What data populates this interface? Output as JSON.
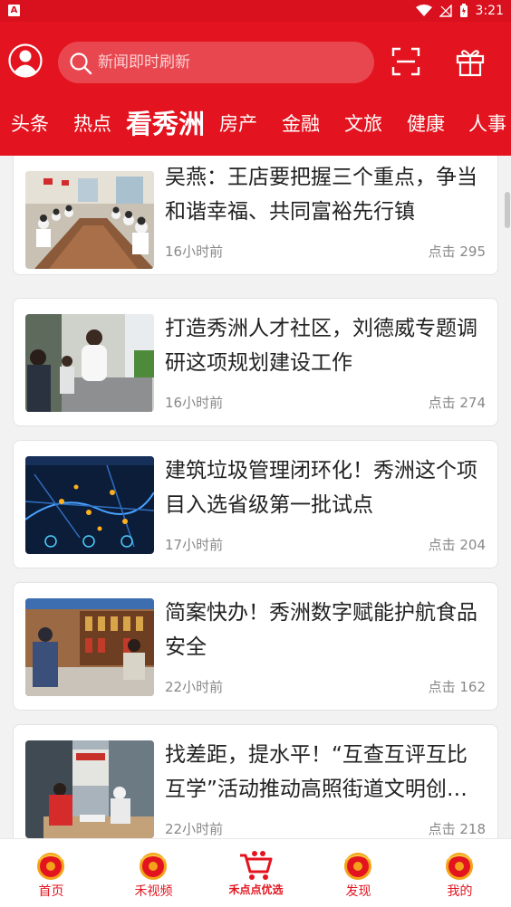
{
  "status_bar": {
    "time": "3:21",
    "notification_letter": "A"
  },
  "search": {
    "placeholder": "新闻即时刷新"
  },
  "tabs": [
    {
      "label": "头条"
    },
    {
      "label": "热点"
    },
    {
      "label": "看秀洲",
      "active": true
    },
    {
      "label": "房产"
    },
    {
      "label": "金融"
    },
    {
      "label": "文旅"
    },
    {
      "label": "健康"
    },
    {
      "label": "人事"
    }
  ],
  "articles": [
    {
      "title": "吴燕：王店要把握三个重点，争当和谐幸福、共同富裕先行镇",
      "time": "16小时前",
      "clicks": "点击 295",
      "thumb": "meeting-room-photo"
    },
    {
      "title": "打造秀洲人才社区，刘德威专题调研这项规划建设工作",
      "time": "16小时前",
      "clicks": "点击 274",
      "thumb": "officials-inspection-photo"
    },
    {
      "title": "建筑垃圾管理闭环化！秀洲这个项目入选省级第一批试点",
      "time": "17小时前",
      "clicks": "点击 204",
      "thumb": "monitoring-screen-photo"
    },
    {
      "title": "简案快办！秀洲数字赋能护航食品安全",
      "time": "22小时前",
      "clicks": "点击 162",
      "thumb": "shop-inspection-photo"
    },
    {
      "title": "找差距，提水平！“互查互评互比互学”活动推动高照街道文明创…",
      "time": "22小时前",
      "clicks": "点击 218",
      "thumb": "volunteer-desk-photo"
    }
  ],
  "bottom_nav": [
    {
      "label": "首页",
      "icon": "lantern-icon"
    },
    {
      "label": "禾视频",
      "icon": "lantern-icon"
    },
    {
      "label": "禾点点优选",
      "icon": "shopping-cart-icon"
    },
    {
      "label": "发现",
      "icon": "lantern-icon"
    },
    {
      "label": "我的",
      "icon": "lantern-icon"
    }
  ],
  "colors": {
    "brand_red": "#e3141f",
    "text_dark": "#222222",
    "text_gray": "#888888"
  }
}
